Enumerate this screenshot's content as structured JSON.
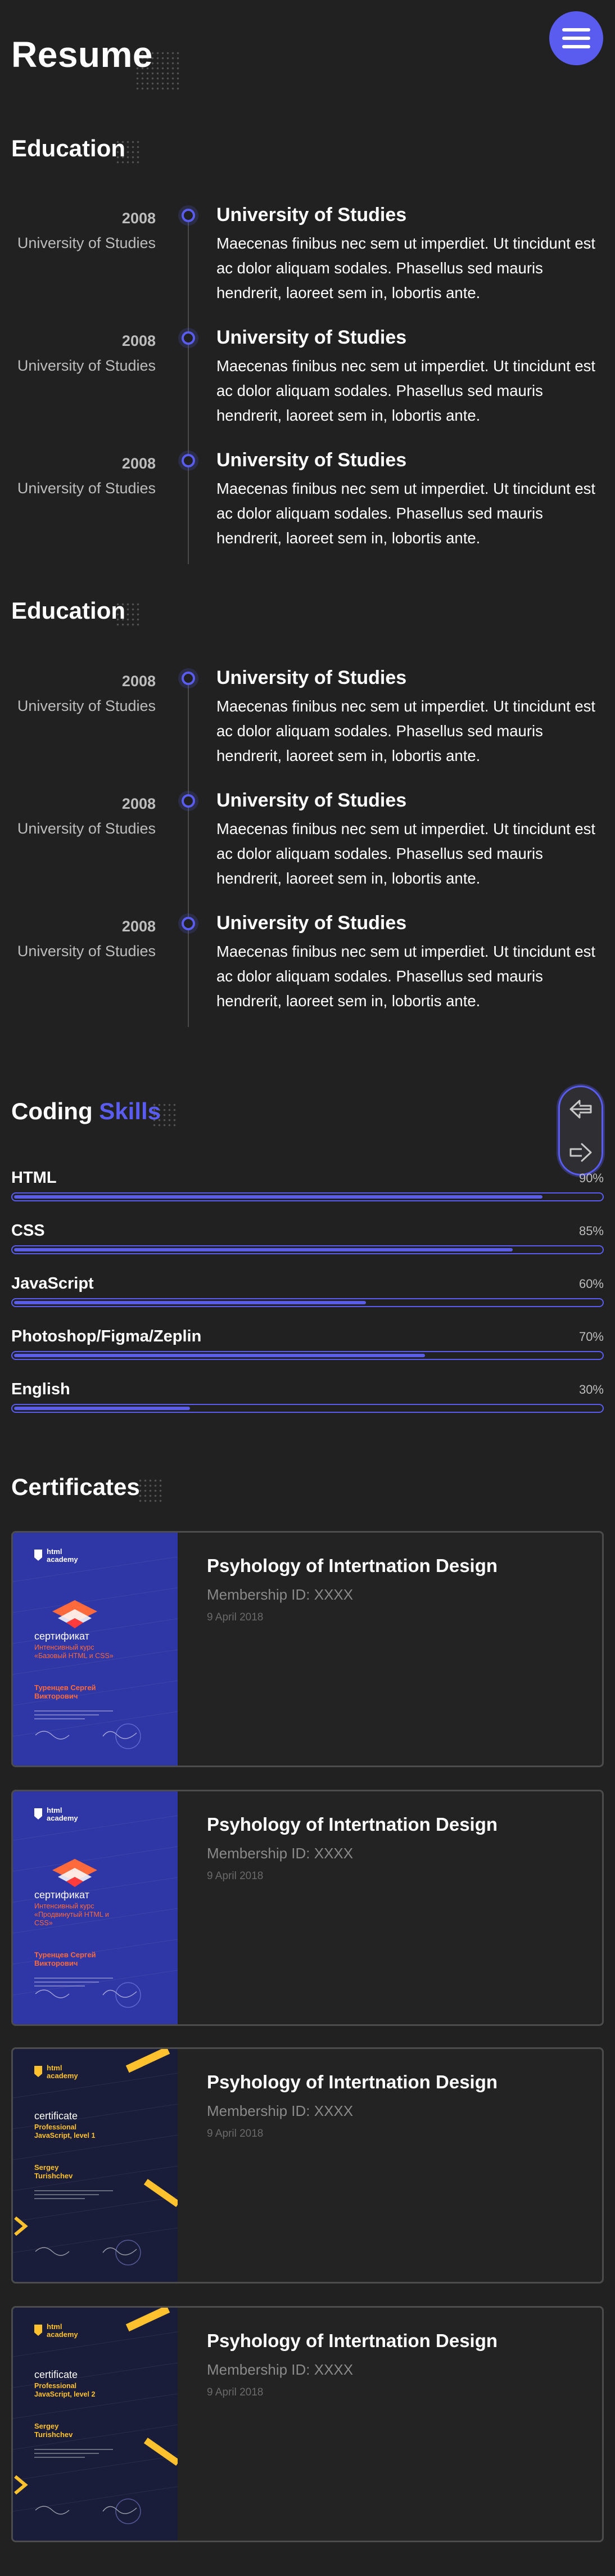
{
  "header": {
    "title": "Resume",
    "menu_icon": "hamburger-icon"
  },
  "education_sections": [
    {
      "title": "Education",
      "items": [
        {
          "year": "2008",
          "place": "University of Studies",
          "title": "University of Studies",
          "text": "Maecenas finibus nec sem ut imperdiet. Ut tincidunt est ac dolor aliquam sodales. Phasellus sed mauris hendrerit, laoreet sem in, lobortis ante."
        },
        {
          "year": "2008",
          "place": "University of Studies",
          "title": "University of Studies",
          "text": "Maecenas finibus nec sem ut imperdiet. Ut tincidunt est ac dolor aliquam sodales. Phasellus sed mauris hendrerit, laoreet sem in, lobortis ante."
        },
        {
          "year": "2008",
          "place": "University of Studies",
          "title": "University of Studies",
          "text": "Maecenas finibus nec sem ut imperdiet. Ut tincidunt est ac dolor aliquam sodales. Phasellus sed mauris hendrerit, laoreet sem in, lobortis ante."
        }
      ]
    },
    {
      "title": "Education",
      "items": [
        {
          "year": "2008",
          "place": "University of Studies",
          "title": "University of Studies",
          "text": "Maecenas finibus nec sem ut imperdiet. Ut tincidunt est ac dolor aliquam sodales. Phasellus sed mauris hendrerit, laoreet sem in, lobortis ante."
        },
        {
          "year": "2008",
          "place": "University of Studies",
          "title": "University of Studies",
          "text": "Maecenas finibus nec sem ut imperdiet. Ut tincidunt est ac dolor aliquam sodales. Phasellus sed mauris hendrerit, laoreet sem in, lobortis ante."
        },
        {
          "year": "2008",
          "place": "University of Studies",
          "title": "University of Studies",
          "text": "Maecenas finibus nec sem ut imperdiet. Ut tincidunt est ac dolor aliquam sodales. Phasellus sed mauris hendrerit, laoreet sem in, lobortis ante."
        }
      ]
    }
  ],
  "skills": {
    "title_main": "Coding",
    "title_accent": "Skills",
    "items": [
      {
        "name": "HTML",
        "percent_label": "90%",
        "level": 0.9
      },
      {
        "name": "CSS",
        "percent_label": "85%",
        "level": 0.85
      },
      {
        "name": "JavaScript",
        "percent_label": "60%",
        "level": 0.6
      },
      {
        "name": "Photoshop/Figma/Zeplin",
        "percent_label": "70%",
        "level": 0.7
      },
      {
        "name": "English",
        "percent_label": "30%",
        "level": 0.3
      }
    ]
  },
  "scroll_controls": {
    "up_icon": "arrow-left-icon",
    "down_icon": "arrow-right-icon"
  },
  "certificates": {
    "title": "Certificates",
    "items": [
      {
        "title": "Psyhology of Intertnation Design",
        "membership": "Membership ID: XXXX",
        "date": "9 April 2018",
        "image": {
          "brand": "html academy",
          "heading": "сертификат",
          "course": "Интенсивный курс «Базовый HTML и CSS»",
          "name": "Туренцев Сергей Викторович",
          "theme": "blue",
          "bg": "#2f36a6",
          "accent": "#ff6a3d"
        }
      },
      {
        "title": "Psyhology of Intertnation Design",
        "membership": "Membership ID: XXXX",
        "date": "9 April 2018",
        "image": {
          "brand": "html academy",
          "heading": "сертификат",
          "course": "Интенсивный курс «Продвинутый HTML и CSS»",
          "name": "Туренцев Сергей Викторович",
          "theme": "blue",
          "bg": "#2f36a6",
          "accent": "#ff6a3d"
        }
      },
      {
        "title": "Psyhology of Intertnation Design",
        "membership": "Membership ID: XXXX",
        "date": "9 April 2018",
        "image": {
          "brand": "html academy",
          "heading": "certificate",
          "course": "Professional JavaScript, level 1",
          "name": "Sergey Turishchev",
          "theme": "dark",
          "bg": "#1a1d3a",
          "accent": "#ffc12e"
        }
      },
      {
        "title": "Psyhology of Intertnation Design",
        "membership": "Membership ID: XXXX",
        "date": "9 April 2018",
        "image": {
          "brand": "html academy",
          "heading": "certificate",
          "course": "Professional JavaScript, level 2",
          "name": "Sergey Turishchev",
          "theme": "dark",
          "bg": "#1a1d3a",
          "accent": "#ffc12e"
        }
      }
    ]
  },
  "colors": {
    "accent": "#5a5cf0",
    "background": "#212121",
    "muted_text": "#bdbdbd"
  }
}
